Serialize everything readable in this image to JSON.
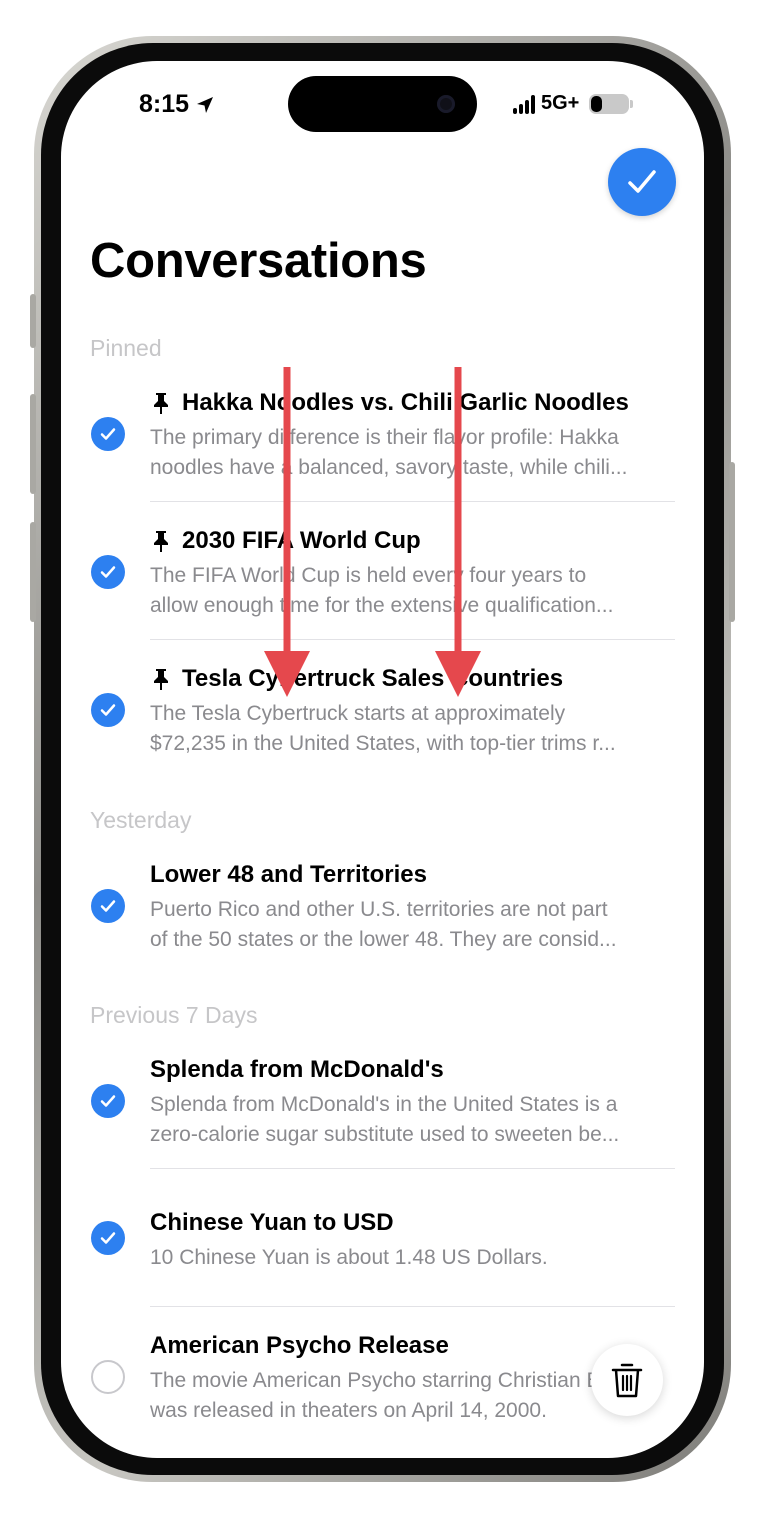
{
  "status_bar": {
    "time": "8:15",
    "network": "5G+",
    "location_icon": "location-arrow-icon",
    "signal_icon": "cellular-signal-icon",
    "battery_icon": "battery-icon",
    "battery_level": 0.3
  },
  "header": {
    "title": "Conversations",
    "done_icon": "checkmark-icon"
  },
  "sections": [
    {
      "label": "Pinned",
      "items": [
        {
          "pinned": true,
          "selected": true,
          "title": "Hakka Noodles vs. Chili Garlic Noodles",
          "preview_line1": "The primary difference is their flavor profile: Hakka",
          "preview_line2": "noodles have a balanced, savory taste, while chili..."
        },
        {
          "pinned": true,
          "selected": true,
          "title": "2030 FIFA World Cup",
          "preview_line1": "The FIFA World Cup is held every four years to",
          "preview_line2": "allow enough time for the extensive qualification..."
        },
        {
          "pinned": true,
          "selected": true,
          "title": "Tesla Cybertruck Sales Countries",
          "preview_line1": "The Tesla Cybertruck starts at approximately",
          "preview_line2": "$72,235 in the United States, with top-tier trims r..."
        }
      ]
    },
    {
      "label": "Yesterday",
      "items": [
        {
          "pinned": false,
          "selected": true,
          "title": "Lower 48 and Territories",
          "preview_line1": "Puerto Rico and other U.S. territories are not part",
          "preview_line2": "of the 50 states or the lower 48. They are consid..."
        }
      ]
    },
    {
      "label": "Previous 7 Days",
      "items": [
        {
          "pinned": false,
          "selected": true,
          "title": "Splenda from McDonald's",
          "preview_line1": "Splenda from McDonald's in the United States is a",
          "preview_line2": "zero-calorie sugar substitute used to sweeten be..."
        },
        {
          "pinned": false,
          "selected": true,
          "title": "Chinese Yuan to USD",
          "preview_line1": "10 Chinese Yuan is about 1.48 US Dollars.",
          "preview_line2": ""
        },
        {
          "pinned": false,
          "selected": false,
          "title": "American Psycho Release",
          "preview_line1": "The movie American Psycho starring Christian Bale",
          "preview_line2": "was released in theaters on April 14, 2000."
        }
      ]
    }
  ],
  "toolbar": {
    "trash_icon": "trash-icon"
  },
  "colors": {
    "accent": "#2d80f0",
    "annotation_arrow": "#e5484d",
    "section_header": "#c6c6c8",
    "preview_text": "#8a8a8e"
  }
}
